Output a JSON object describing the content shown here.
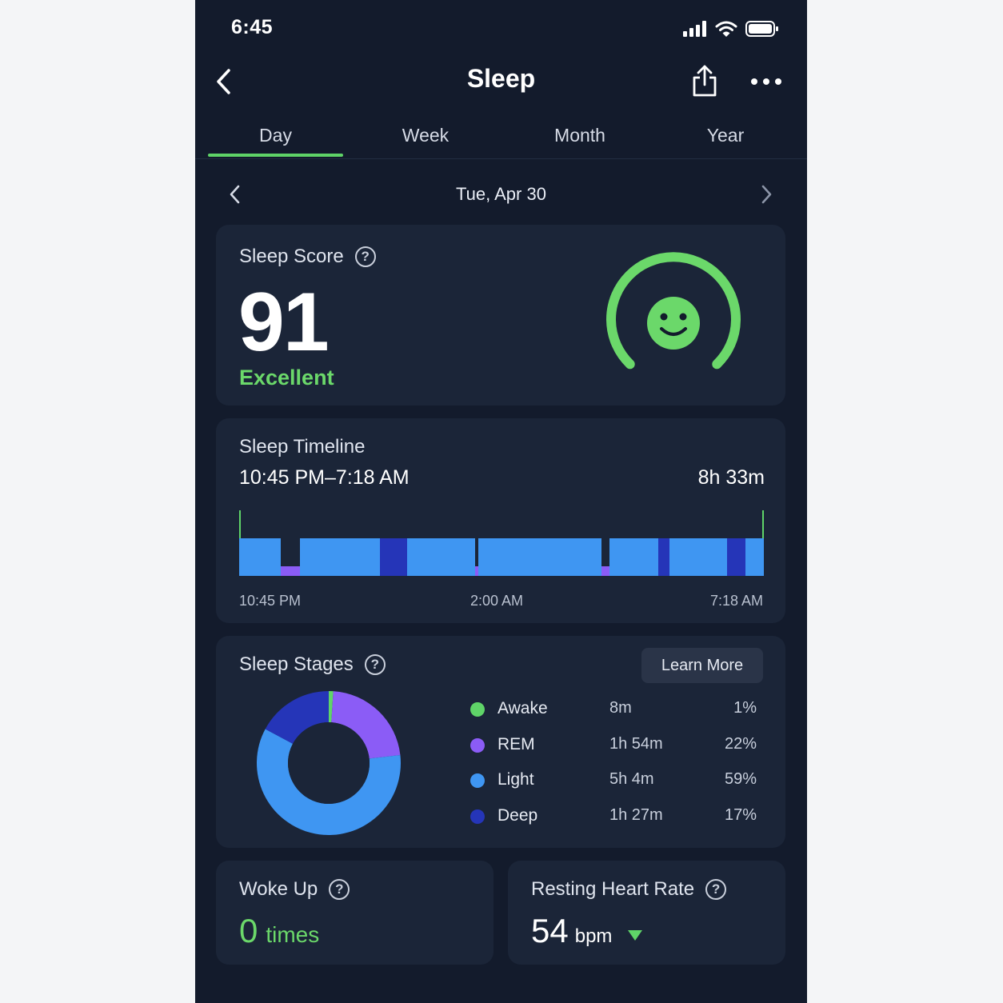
{
  "status_bar": {
    "time": "6:45"
  },
  "nav": {
    "title": "Sleep"
  },
  "tabs": [
    {
      "label": "Day",
      "active": true
    },
    {
      "label": "Week",
      "active": false
    },
    {
      "label": "Month",
      "active": false
    },
    {
      "label": "Year",
      "active": false
    }
  ],
  "date_nav": {
    "date": "Tue, Apr 30"
  },
  "sleep_score": {
    "title": "Sleep Score",
    "score": "91",
    "rating": "Excellent"
  },
  "sleep_timeline": {
    "title": "Sleep Timeline",
    "range": "10:45 PM–7:18 AM",
    "duration": "8h 33m",
    "axis_start": "10:45 PM",
    "axis_mid": "2:00 AM",
    "axis_end": "7:18 AM"
  },
  "sleep_stages": {
    "title": "Sleep Stages",
    "learn_more": "Learn More",
    "stages": [
      {
        "name": "Awake",
        "duration": "8m",
        "percent": "1%",
        "value": 1,
        "color": "#5fd468"
      },
      {
        "name": "REM",
        "duration": "1h 54m",
        "percent": "22%",
        "value": 22,
        "color": "#8b5cf6"
      },
      {
        "name": "Light",
        "duration": "5h 4m",
        "percent": "59%",
        "value": 59,
        "color": "#3f96f2"
      },
      {
        "name": "Deep",
        "duration": "1h 27m",
        "percent": "17%",
        "value": 17,
        "color": "#2535b8"
      }
    ]
  },
  "woke_up": {
    "title": "Woke Up",
    "count": "0",
    "unit": "times"
  },
  "resting_hr": {
    "title": "Resting Heart Rate",
    "value": "54",
    "unit": "bpm"
  },
  "colors": {
    "accent": "#5fd468",
    "background": "#131b2c",
    "card": "#1b2538"
  }
}
